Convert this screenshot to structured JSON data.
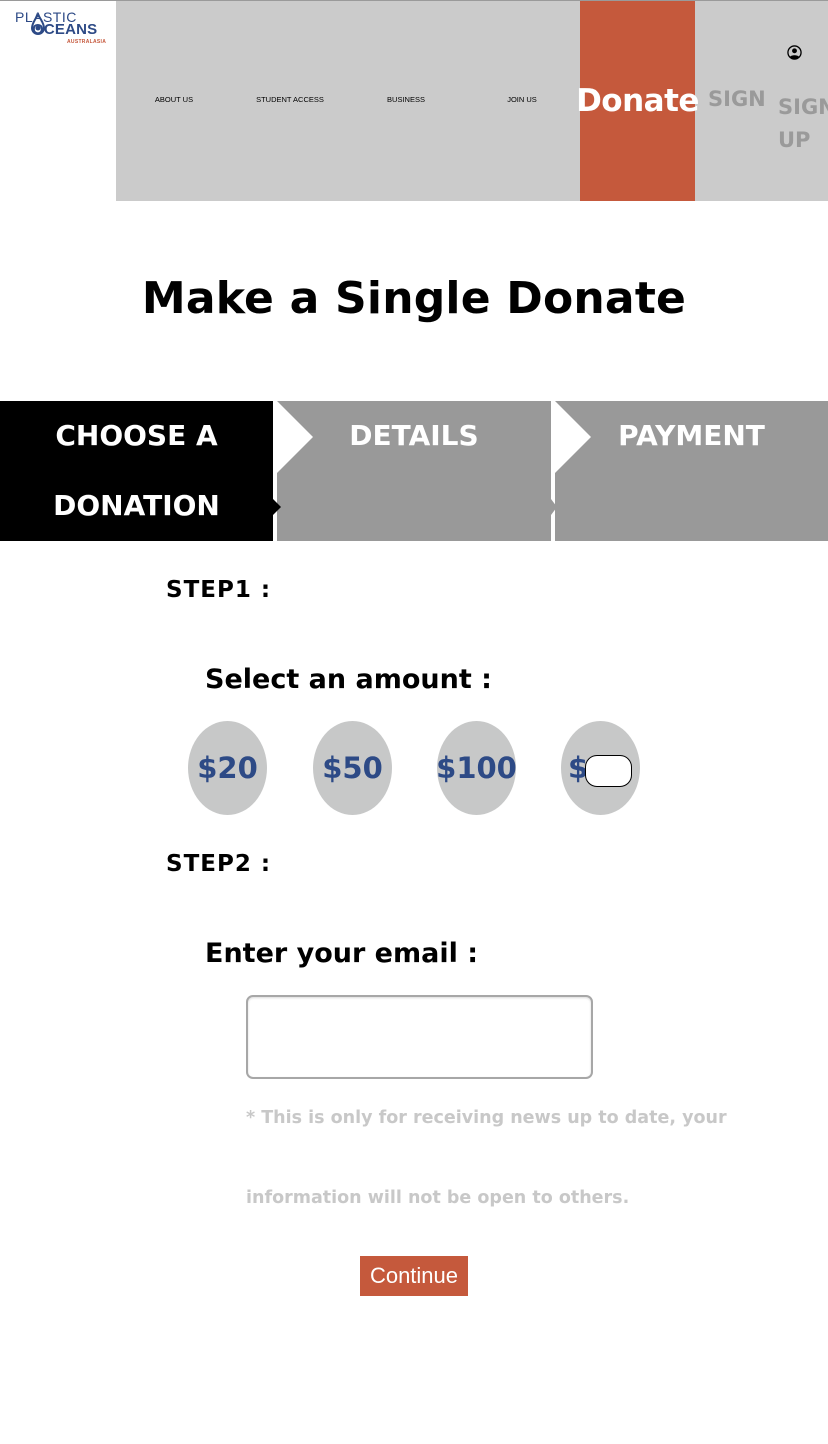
{
  "logo": {
    "line1": "PLASTIC",
    "line2": "OCEANS",
    "line3": "AUSTRALASIA"
  },
  "nav": {
    "items": [
      "ABOUT US",
      "STUDENT ACCESS",
      "BUSINESS",
      "JOIN US"
    ],
    "donate": "Donate",
    "sign_in": "SIGN",
    "sign_up": "SIGN UP"
  },
  "page": {
    "title": "Make a Single Donate"
  },
  "steps": [
    {
      "label": "CHOOSE A DONATION"
    },
    {
      "label": "DETAILS"
    },
    {
      "label": "PAYMENT"
    }
  ],
  "form": {
    "step1": "STEP1 :",
    "select_amount": "Select an amount :",
    "amounts": [
      "$20",
      "$50",
      "$100",
      "$"
    ],
    "step2": "STEP2 :",
    "enter_email": "Enter your email :",
    "email_value": "",
    "note_line1": "* This is only for receiving news up to date, your",
    "note_line2": "information will not be open to others.",
    "continue": "Continue"
  },
  "colors": {
    "accent": "#c5593c",
    "nav_bg": "#cbcbcb",
    "step_active": "#000000",
    "step_inactive": "#999999",
    "amount_text": "#2d4a86",
    "amount_bg": "#c7c8c8"
  }
}
